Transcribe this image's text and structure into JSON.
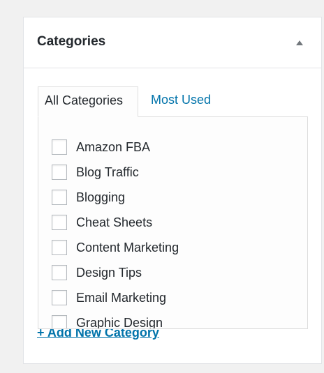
{
  "panel": {
    "title": "Categories",
    "toggle_icon": "triangle-up-icon"
  },
  "tabs": [
    {
      "label": "All Categories",
      "active": true
    },
    {
      "label": "Most Used",
      "active": false
    }
  ],
  "categories": [
    {
      "label": "Amazon FBA",
      "checked": false
    },
    {
      "label": "Blog Traffic",
      "checked": false
    },
    {
      "label": "Blogging",
      "checked": false
    },
    {
      "label": "Cheat Sheets",
      "checked": false
    },
    {
      "label": "Content Marketing",
      "checked": false
    },
    {
      "label": "Design Tips",
      "checked": false
    },
    {
      "label": "Email Marketing",
      "checked": false
    },
    {
      "label": "Graphic Design",
      "checked": false
    }
  ],
  "add_link": "+ Add New Category",
  "colors": {
    "link": "#0073aa",
    "text": "#23282d",
    "border": "#dddddd",
    "background": "#f1f1f1"
  }
}
